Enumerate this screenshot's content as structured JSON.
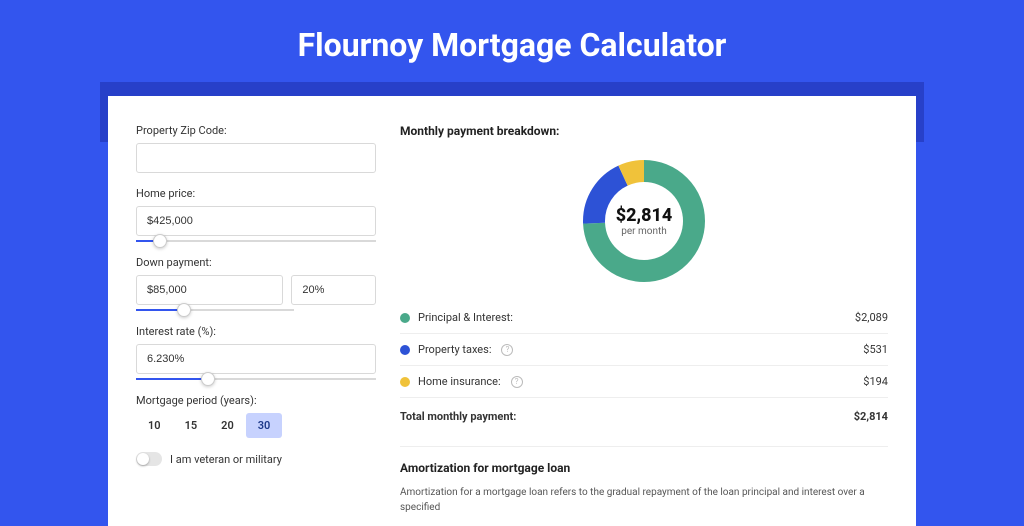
{
  "title": "Flournoy Mortgage Calculator",
  "form": {
    "zip_label": "Property Zip Code:",
    "zip_value": "",
    "home_price_label": "Home price:",
    "home_price_value": "$425,000",
    "down_payment_label": "Down payment:",
    "down_payment_value": "$85,000",
    "down_payment_pct": "20%",
    "interest_label": "Interest rate (%):",
    "interest_value": "6.230%",
    "period_label": "Mortgage period (years):",
    "period_options": [
      "10",
      "15",
      "20",
      "30"
    ],
    "period_selected": "30",
    "veteran_label": "I am veteran or military"
  },
  "breakdown": {
    "title": "Monthly payment breakdown:",
    "center_value": "$2,814",
    "center_sub": "per month",
    "rows": [
      {
        "label": "Principal & Interest:",
        "value": "$2,089",
        "color": "#4aa98a",
        "info": false
      },
      {
        "label": "Property taxes:",
        "value": "$531",
        "color": "#2d52d6",
        "info": true
      },
      {
        "label": "Home insurance:",
        "value": "$194",
        "color": "#f0c23a",
        "info": true
      }
    ],
    "total_label": "Total monthly payment:",
    "total_value": "$2,814"
  },
  "amort": {
    "title": "Amortization for mortgage loan",
    "body": "Amortization for a mortgage loan refers to the gradual repayment of the loan principal and interest over a specified"
  },
  "chart_data": {
    "type": "pie",
    "title": "Monthly payment breakdown",
    "series": [
      {
        "name": "Principal & Interest",
        "value": 2089,
        "color": "#4aa98a"
      },
      {
        "name": "Property taxes",
        "value": 531,
        "color": "#2d52d6"
      },
      {
        "name": "Home insurance",
        "value": 194,
        "color": "#f0c23a"
      }
    ],
    "total": 2814,
    "center_label": "$2,814 per month"
  }
}
